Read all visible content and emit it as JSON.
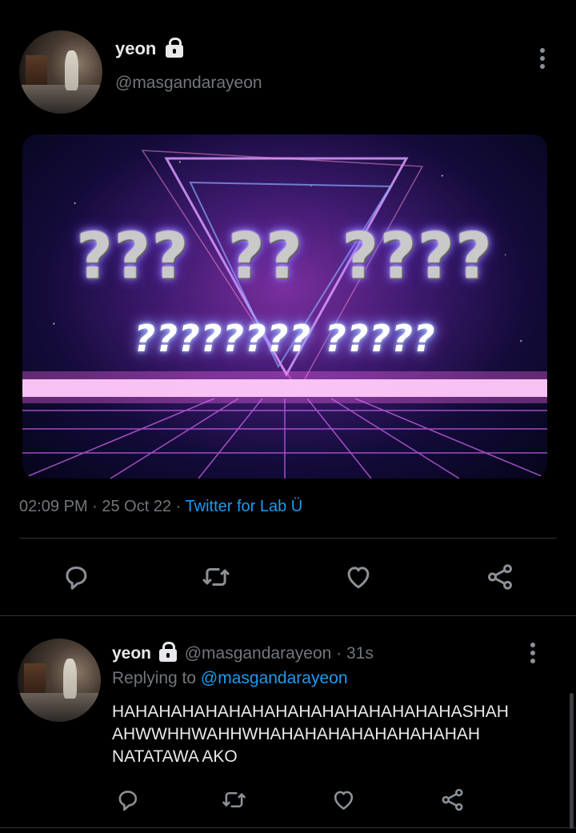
{
  "tweet": {
    "display_name": "yeon",
    "handle": "@masgandarayeon",
    "media_text": {
      "line1": [
        "???",
        "??",
        "????"
      ],
      "line2": "???????? ?????"
    },
    "timestamp": "02:09 PM · 25 Oct 22 · ",
    "source": "Twitter for Lab Ü"
  },
  "reply": {
    "display_name": "yeon",
    "handle": "@masgandarayeon · 31s",
    "replying_prefix": "Replying to ",
    "replying_to": "@masgandarayeon",
    "text_lines": [
      "HAHAHAHAHAHAHAHAHAHAHAHAHAHAHASHAH",
      "AHWWHHWAHHWHAHAHAHAHAHAHAHAHAH",
      "NATATAWA AKO"
    ]
  },
  "icons": {
    "reply": "reply-icon",
    "retweet": "retweet-icon",
    "like": "like-icon",
    "share": "share-icon",
    "more": "more-icon",
    "lock": "lock-icon"
  },
  "colors": {
    "background": "#000000",
    "text": "#e7e9ea",
    "muted": "#71767b",
    "link": "#1d9bf0",
    "divider": "#2f3336"
  }
}
